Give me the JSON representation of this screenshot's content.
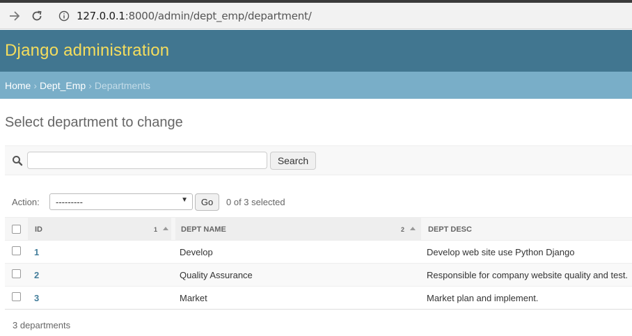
{
  "browser": {
    "url_host": "127.0.0.1",
    "url_rest": ":8000/admin/dept_emp/department/"
  },
  "header": {
    "brand": "Django administration"
  },
  "breadcrumbs": {
    "home": "Home",
    "app": "Dept_Emp",
    "current": "Departments",
    "separator": "›"
  },
  "page": {
    "title": "Select department to change"
  },
  "search": {
    "placeholder": "",
    "value": "",
    "button_label": "Search"
  },
  "actions": {
    "label": "Action:",
    "selected_option": "---------",
    "go_label": "Go",
    "selected_count": "0 of 3 selected"
  },
  "table": {
    "columns": [
      {
        "label": "ID",
        "sort_priority": "1"
      },
      {
        "label": "Dept Name",
        "sort_priority": "2"
      },
      {
        "label": "Dept Desc"
      }
    ],
    "rows": [
      {
        "id": "1",
        "name": "Develop",
        "desc": "Develop web site use Python Django"
      },
      {
        "id": "2",
        "name": "Quality Assurance",
        "desc": "Responsible for company website quality and test."
      },
      {
        "id": "3",
        "name": "Market",
        "desc": "Market plan and implement."
      }
    ]
  },
  "paginator": {
    "text": "3 departments"
  },
  "colors": {
    "header_bg": "#417690",
    "brand_text": "#f5dd5d",
    "breadcrumb_bg": "#79aec8",
    "link": "#447e9b"
  }
}
